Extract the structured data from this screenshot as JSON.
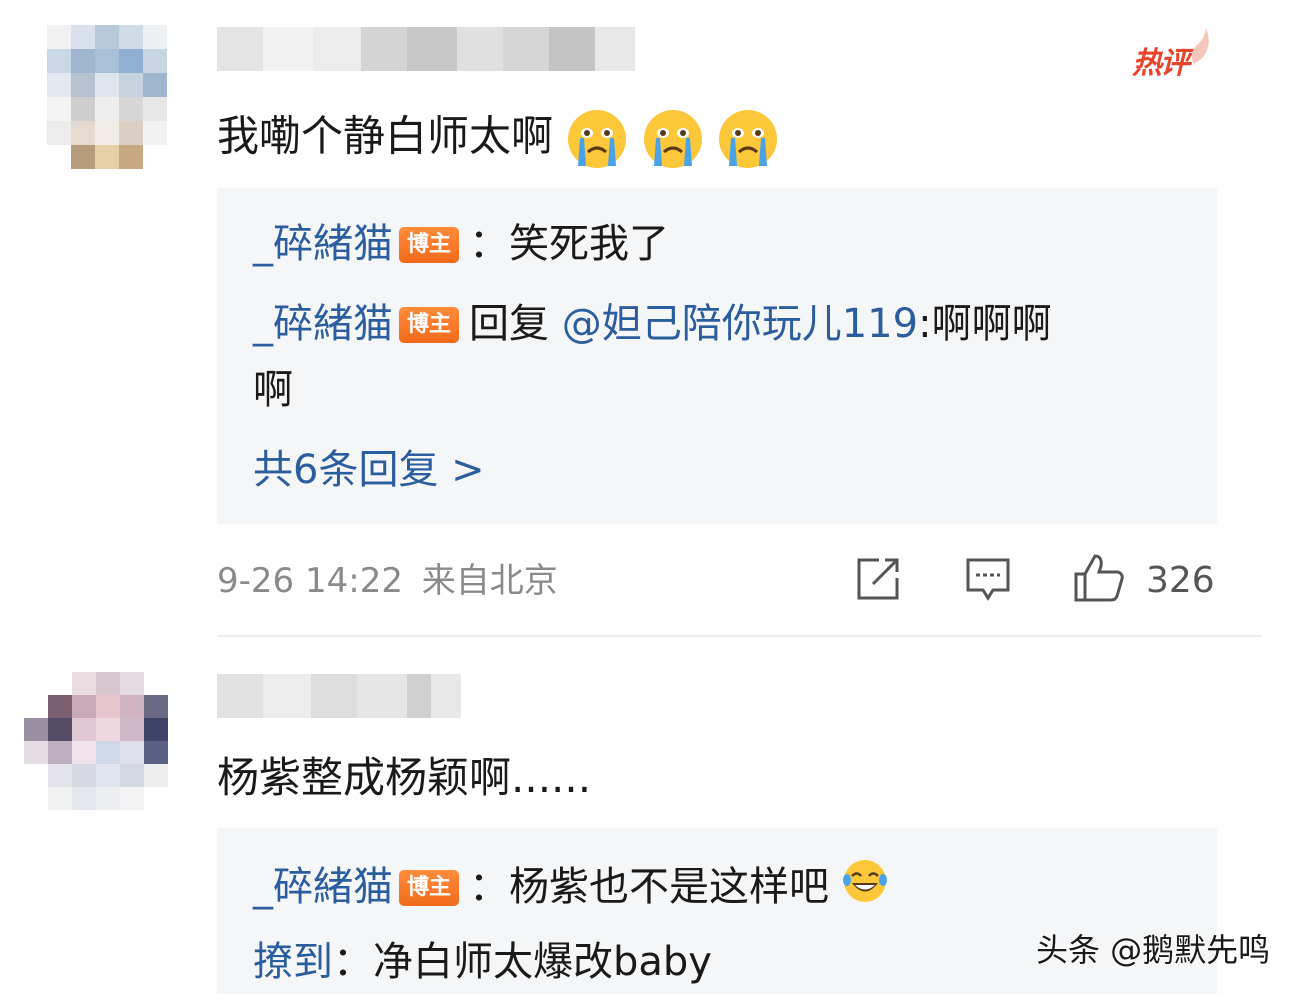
{
  "hot_label": "热评",
  "comments": [
    {
      "text": "我嘞个静白师太啊",
      "emojis": [
        "crying-emoji",
        "crying-emoji",
        "crying-emoji"
      ],
      "replies": [
        {
          "author": "_碎緒猫",
          "badge": "博主",
          "text": "：笑死我了"
        },
        {
          "author": "_碎緒猫",
          "badge": "博主",
          "reply_prefix": "回复 ",
          "mention": "@妲己陪你玩儿119",
          "text": ":啊啊啊",
          "text_cont": "啊"
        }
      ],
      "more_replies": "共6条回复 >",
      "time": "9-26 14:22",
      "location": "来自北京",
      "likes": "326"
    },
    {
      "text": "杨紫整成杨颖啊......",
      "replies": [
        {
          "author": "_碎緒猫",
          "badge": "博主",
          "text": "：杨紫也不是这样吧",
          "emoji": "laughing-tears-emoji"
        },
        {
          "author": "撩到",
          "text": "：净白师太爆改baby"
        }
      ]
    }
  ],
  "watermark": "头条 @鹅默先鸣",
  "colors": {
    "link": "#2b5e9e",
    "badge": "#f26a1b",
    "hot": "#e8462c",
    "reply_bg": "#f5f6f7"
  }
}
